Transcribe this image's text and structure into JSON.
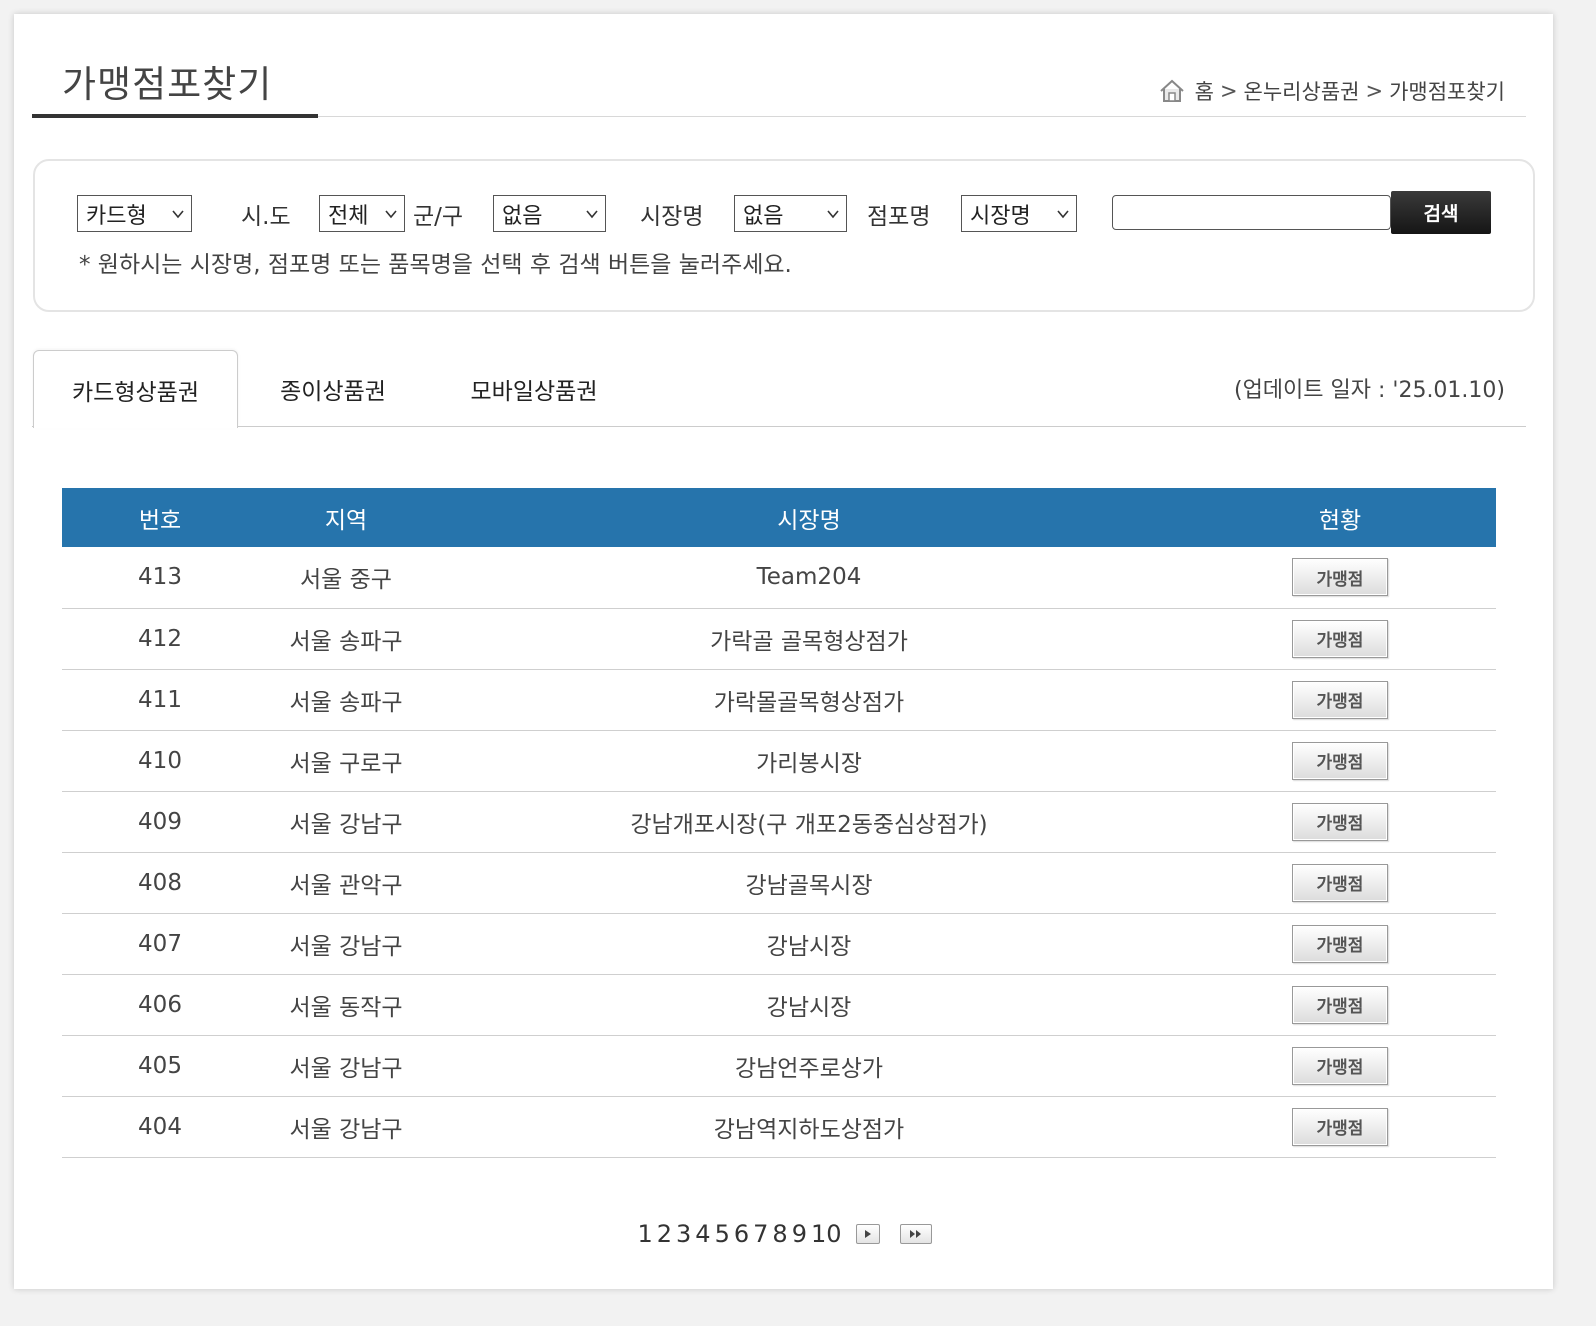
{
  "header": {
    "title": "가맹점포찾기",
    "breadcrumb": [
      "홈",
      "온누리상품권",
      "가맹점포찾기"
    ]
  },
  "search": {
    "type_select": "카드형",
    "sido_label": "시.도",
    "sido_select": "전체",
    "gugun_label": "군/구",
    "gugun_select": "없음",
    "market_label": "시장명",
    "market_select": "없음",
    "shop_label": "점포명",
    "field_select": "시장명",
    "input_value": "",
    "button_label": "검색",
    "hint": "* 원하시는 시장명, 점포명 또는 품목명을 선택 후 검색 버튼을 눌러주세요."
  },
  "tabs": [
    {
      "label": "카드형상품권",
      "active": true
    },
    {
      "label": "종이상품권",
      "active": false
    },
    {
      "label": "모바일상품권",
      "active": false
    }
  ],
  "update_date": "(업데이트 일자 : '25.01.10)",
  "table": {
    "headers": [
      "번호",
      "지역",
      "시장명",
      "현황"
    ],
    "status_button": "가맹점",
    "rows": [
      {
        "no": "413",
        "region": "서울 중구",
        "market": "Team204"
      },
      {
        "no": "412",
        "region": "서울 송파구",
        "market": "가락골 골목형상점가"
      },
      {
        "no": "411",
        "region": "서울 송파구",
        "market": "가락몰골목형상점가"
      },
      {
        "no": "410",
        "region": "서울 구로구",
        "market": "가리봉시장"
      },
      {
        "no": "409",
        "region": "서울 강남구",
        "market": "강남개포시장(구 개포2동중심상점가)"
      },
      {
        "no": "408",
        "region": "서울 관악구",
        "market": "강남골목시장"
      },
      {
        "no": "407",
        "region": "서울 강남구",
        "market": "강남시장"
      },
      {
        "no": "406",
        "region": "서울 동작구",
        "market": "강남시장"
      },
      {
        "no": "405",
        "region": "서울 강남구",
        "market": "강남언주로상가"
      },
      {
        "no": "404",
        "region": "서울 강남구",
        "market": "강남역지하도상점가"
      }
    ]
  },
  "pagination": {
    "pages": [
      "1",
      "2",
      "3",
      "4",
      "5",
      "6",
      "7",
      "8",
      "9",
      "10"
    ]
  }
}
